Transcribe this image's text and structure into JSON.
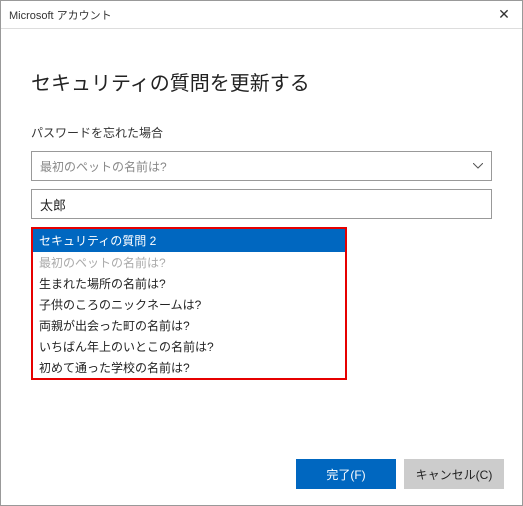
{
  "window": {
    "title": "Microsoft アカウント"
  },
  "main": {
    "heading": "セキュリティの質問を更新する",
    "subheading": "パスワードを忘れた場合"
  },
  "question1": {
    "placeholder": "最初のペットの名前は?"
  },
  "answer1": {
    "value": "太郎"
  },
  "dropdown": {
    "selected": "セキュリティの質問 2",
    "disabled": "最初のペットの名前は?",
    "options": [
      "生まれた場所の名前は?",
      "子供のころのニックネームは?",
      "両親が出会った町の名前は?",
      "いちばん年上のいとこの名前は?",
      "初めて通った学校の名前は?"
    ]
  },
  "buttons": {
    "finish": "完了(F)",
    "cancel": "キャンセル(C)"
  }
}
